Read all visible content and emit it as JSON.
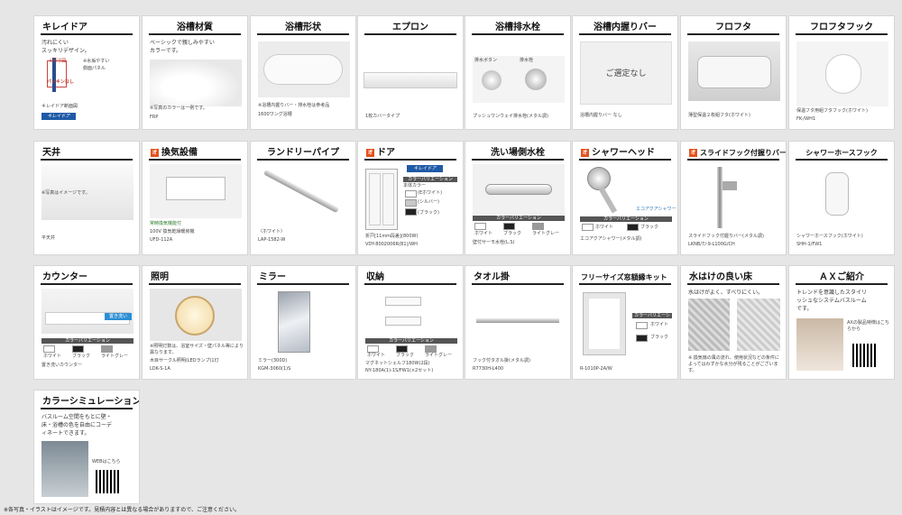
{
  "cards": [
    {
      "title": "キレイドア",
      "desc": [
        "汚れにくい",
        "スッキリデザイン。"
      ],
      "caption": "キレイドア断面図",
      "badge": "キレイドア",
      "labels": [
        "※原寸図",
        "※水垢やすい",
        "側面パネル",
        "パッキンなし"
      ]
    },
    {
      "title": "浴槽材質",
      "desc": [
        "ベーシックで親しみやすい",
        "カラーです。"
      ],
      "note": "※写真のカラーは一例です。",
      "caption": "FRP"
    },
    {
      "title": "浴槽形状",
      "caption": "※浴槽内握りバー・排水栓は参考品",
      "caption2": "1600ワング浴槽"
    },
    {
      "title": "エプロン",
      "caption": "1枚カバータイプ"
    },
    {
      "title": "浴槽排水栓",
      "labels": [
        "排水ボタン",
        "排水栓"
      ],
      "caption": "プッシュワンウェイ排水栓(メタル調)"
    },
    {
      "title": "浴槽内握りバー",
      "placeholder": "ご選定なし",
      "caption": "浴槽内握りバー なし"
    },
    {
      "title": "フロフタ",
      "caption": "薄型保温２枚組フタ(ホワイト)"
    },
    {
      "title": "フロフタフック",
      "caption": "保温フタ用組フタフック(ホワイト)",
      "caption2": "FK-/WH1"
    },
    {
      "title": "天井",
      "note": "※写真はイメージです。",
      "caption": "平天井"
    },
    {
      "title": "換気設備",
      "option": true,
      "sub": "常時換気機能付",
      "caption": "100V 換気乾燥暖房機",
      "caption2": "UFD-112A"
    },
    {
      "title": "ランドリーパイプ",
      "caption": "〈ホワイト〉",
      "caption2": "LAP-1582-W"
    },
    {
      "title": "ドア",
      "option": true,
      "badge": "キレイドア",
      "colorTitle": "カラーバリエーション",
      "colors": [
        "本体カラー",
        "(Eホワイト)",
        "(シルバー)",
        "(ブラック)"
      ],
      "caption": "折戸[11mm段差](800W)",
      "caption2": "VDY-8002006R(B1)/WH"
    },
    {
      "title": "洗い場側水栓",
      "colorTitle": "カラーバリエーション",
      "colors": [
        "ホワイト",
        "ブラック",
        "ライトグレー"
      ],
      "caption": "壁付サーモ水栓(L.S)"
    },
    {
      "title": "シャワーヘッド",
      "option": true,
      "colorTitle": "カラーバリエーション",
      "colors": [
        "ホワイト",
        "ブラック"
      ],
      "badge": "エコアクアシャワー",
      "caption": "エコアクアシャワー(メタル調)"
    },
    {
      "title": "スライドフック付握りバー",
      "option": true,
      "caption": "スライドフック付握りバー(メタル調)",
      "caption2": "LKNB/7/-9-L100G/CH"
    },
    {
      "title": "シャワーホースフック",
      "caption": "シャワーホースフック(ホワイト)",
      "caption2": "SHH-1/FW1"
    },
    {
      "title": "カウンター",
      "badge": "置き洗い",
      "colorTitle": "カラーバリエーション",
      "colors": [
        "ホワイト",
        "ブラック",
        "ライトグレー"
      ],
      "caption": "置き洗いカウンター"
    },
    {
      "title": "照明",
      "note": "※照明灯数は、浴室サイズ・壁パネル等により異なります。",
      "caption": "木目サークル照明(LEDランプ)1灯",
      "caption2": "LDK-S-1A"
    },
    {
      "title": "ミラー",
      "caption": "ミラー(300D)",
      "caption2": "KGM-3060(1)S"
    },
    {
      "title": "収納",
      "colorTitle": "カラーバリエーション",
      "colors": [
        "ホワイト",
        "ブラック",
        "ライトグレー"
      ],
      "caption": "マグネットシェルフ180W(2段)",
      "caption2": "NY-180A(1)-1S/FW1(×2セット)"
    },
    {
      "title": "タオル掛",
      "caption": "フック付タオル掛(メタル調)",
      "caption2": "R7730H-L400"
    },
    {
      "title": "フリーサイズ窓額縁キット",
      "colorTitle": "カラーバリエーション",
      "colors": [
        "ホワイト",
        "ブラック"
      ],
      "caption": "R-1010P-2A/W"
    },
    {
      "title": "水はけの良い床",
      "desc": [
        "水はけがよく、すべりにくい。"
      ],
      "note": "※ 換気扇の風の流れ、使用状況などの条件によってはわずかな水分が残ることがございます。"
    },
    {
      "title": "ＡＸご紹介",
      "desc": [
        "トレンドを意識したスタイリ",
        "ッシュなシステムバスルーム",
        "です。"
      ],
      "qrLabel": "AXの製品特徴はこちらから"
    },
    {
      "title": "カラーシミュレーション",
      "desc": [
        "バスルーム空間をもとに壁・",
        "床・浴槽の色を自由にコーデ",
        "ィネートできます。"
      ],
      "qrLabel": "WEBはこちら"
    }
  ],
  "footer_note": "※各写真・イラストはイメージです。見積内容とは異なる場合がありますので、ご注意ください。"
}
